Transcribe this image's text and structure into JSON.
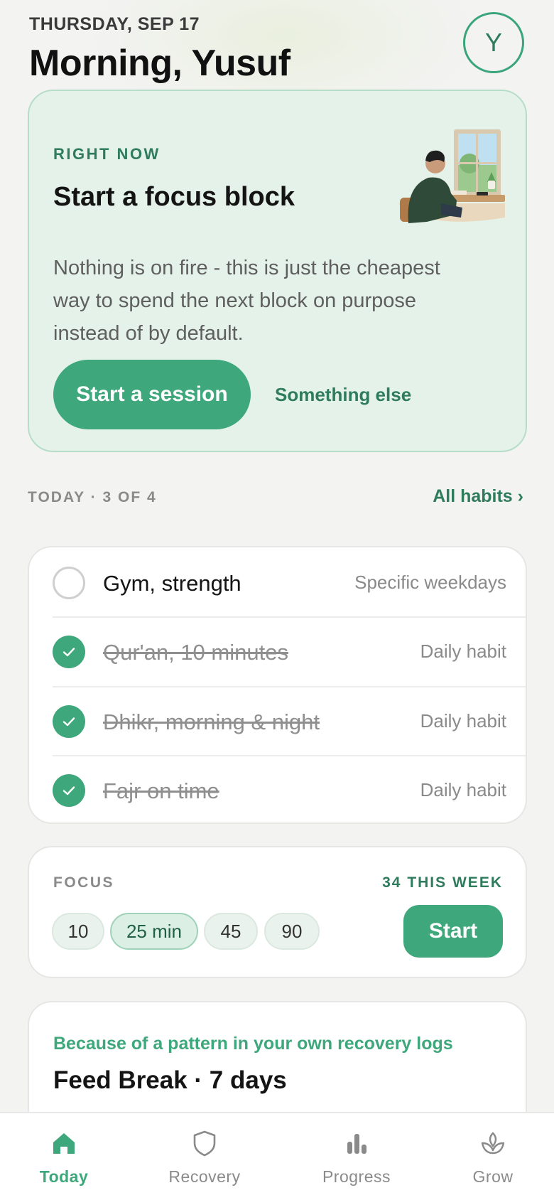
{
  "header": {
    "date": "THURSDAY, SEP 17",
    "greeting": "Morning, Yusuf",
    "avatar_initial": "Y"
  },
  "hero": {
    "kicker": "RIGHT NOW",
    "title": "Start a focus block",
    "description": "Nothing is on fire - this is just the cheapest way to spend the next block on purpose instead of by default.",
    "primary_button": "Start a session",
    "secondary_link": "Something else"
  },
  "today": {
    "label": "TODAY · 3 OF 4",
    "all_habits_link": "All habits ›",
    "habits": [
      {
        "name": "Gym, strength",
        "frequency": "Specific weekdays",
        "done": false
      },
      {
        "name": "Qur'an, 10 minutes",
        "frequency": "Daily habit",
        "done": true
      },
      {
        "name": "Dhikr, morning & night",
        "frequency": "Daily habit",
        "done": true
      },
      {
        "name": "Fajr on time",
        "frequency": "Daily habit",
        "done": true
      }
    ]
  },
  "focus": {
    "label": "FOCUS",
    "week_total": "34 THIS WEEK",
    "durations": [
      "10",
      "25 min",
      "45",
      "90"
    ],
    "selected_duration": "25 min",
    "start_button": "Start"
  },
  "insight": {
    "subtitle": "Because of a pattern in your own recovery logs",
    "headline": "Feed Break · 7 days"
  },
  "tabbar": {
    "tabs": [
      {
        "label": "Today",
        "icon": "home-icon",
        "active": true
      },
      {
        "label": "Recovery",
        "icon": "shield-icon",
        "active": false
      },
      {
        "label": "Progress",
        "icon": "bar-chart-icon",
        "active": false
      },
      {
        "label": "Grow",
        "icon": "sprout-icon",
        "active": false
      }
    ]
  },
  "colors": {
    "accent": "#3ea77b",
    "accent_dark": "#2f7c5c",
    "hero_bg": "#e4f2ea",
    "page_bg": "#f3f3f2"
  }
}
